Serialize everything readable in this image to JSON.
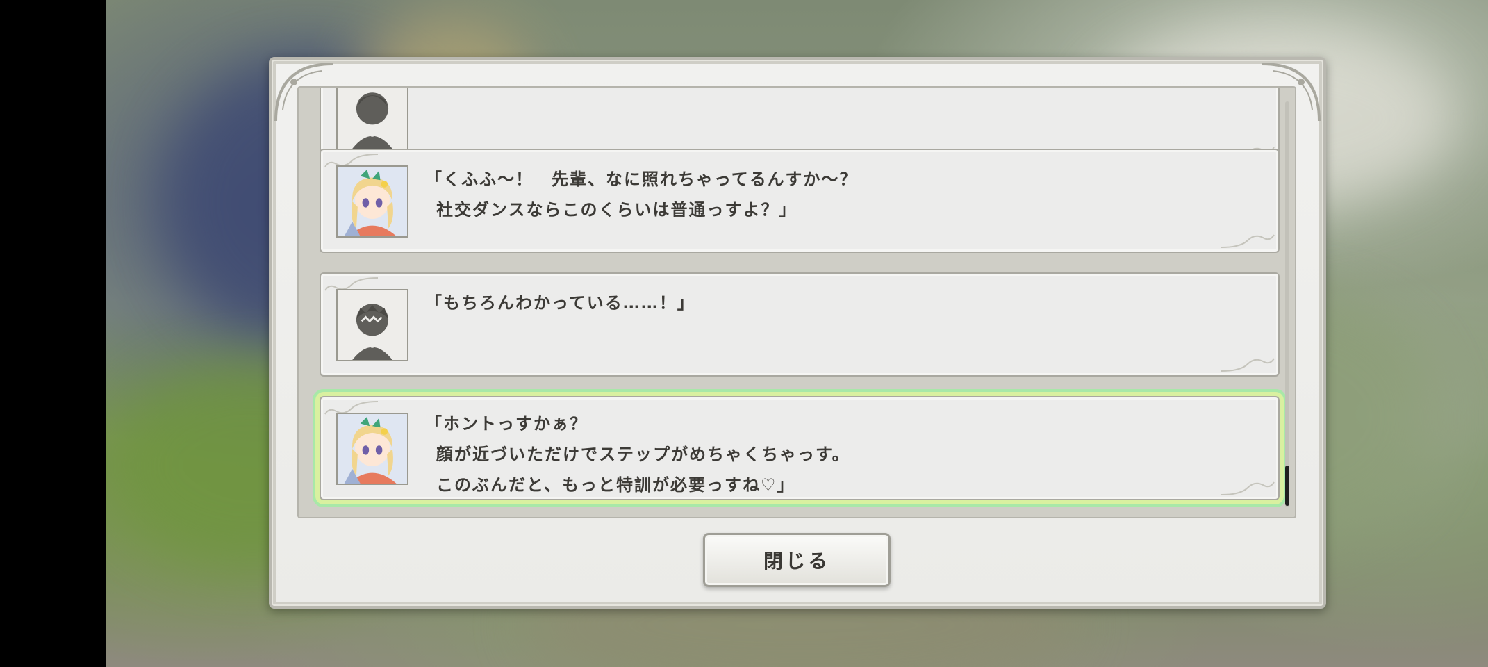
{
  "backlog": {
    "entries": [
      {
        "speaker": "protagonist",
        "icon": "silhouette-icon",
        "lines": []
      },
      {
        "speaker": "blonde-girl",
        "icon": "blonde-girl-portrait",
        "lines": [
          "「くふふ～！　先輩、なに照れちゃってるんすか～？",
          "社交ダンスならこのくらいは普通っすよ？」"
        ]
      },
      {
        "speaker": "protagonist",
        "icon": "silhouette-icon",
        "lines": [
          "「もちろんわかっている……！」"
        ]
      },
      {
        "speaker": "blonde-girl",
        "icon": "blonde-girl-portrait",
        "lines": [
          "「ホントっすかぁ？",
          "顔が近づいただけでステップがめちゃくちゃっす。",
          "このぶんだと、もっと特訓が必要っすね♡」"
        ]
      }
    ]
  },
  "close_button": {
    "label": "閉じる"
  },
  "colors": {
    "highlight_outer": "#a8e8a8",
    "highlight_inner": "#d9f0a0",
    "panel": "#ececeb",
    "text": "#3c3a36"
  }
}
